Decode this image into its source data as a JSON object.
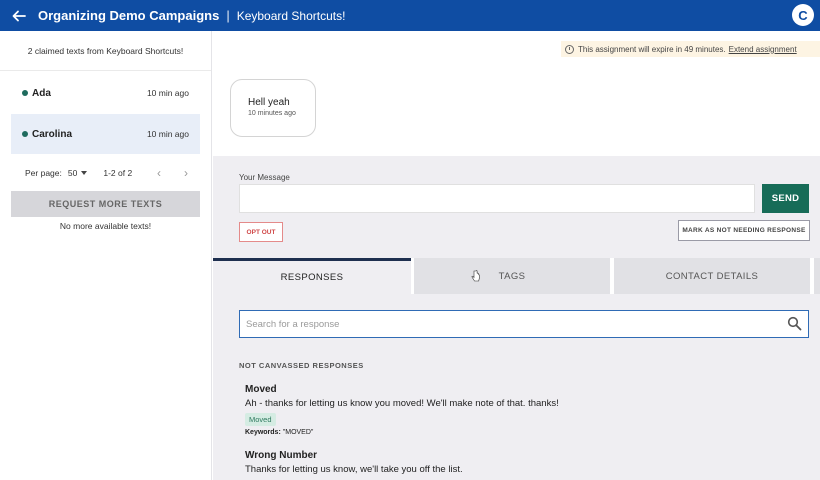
{
  "header": {
    "campaign": "Organizing Demo Campaigns",
    "separator": "|",
    "subtitle": "Keyboard Shortcuts!",
    "avatar_initial": "C",
    "bg_color": "#0f4da3"
  },
  "sidebar": {
    "claimed_text": "2 claimed texts from Keyboard Shortcuts!",
    "contacts": [
      {
        "name": "Ada",
        "time": "10 min ago",
        "active": false
      },
      {
        "name": "Carolina",
        "time": "10 min ago",
        "active": true
      }
    ],
    "pagination": {
      "per_page_label": "Per page:",
      "per_page_value": "50",
      "range": "1-2 of 2",
      "prev_icon": "chevron-left-icon",
      "next_icon": "chevron-right-icon"
    },
    "request_button": "REQUEST MORE TEXTS",
    "no_more": "No more available texts!"
  },
  "main": {
    "expire": {
      "text": "This assignment will expire in 49 minutes.",
      "link": "Extend assignment"
    },
    "message": {
      "text": "Hell yeah",
      "time": "10 minutes ago"
    },
    "compose": {
      "label": "Your Message",
      "input_value": "",
      "send_button": "SEND",
      "opt_out_button": "OPT OUT",
      "mark_button": "MARK AS NOT NEEDING RESPONSE",
      "send_color": "#176c58"
    },
    "tabs": [
      {
        "label": "RESPONSES",
        "active": true
      },
      {
        "label": "TAGS",
        "active": false
      },
      {
        "label": "CONTACT DETAILS",
        "active": false
      }
    ],
    "responses": {
      "search_placeholder": "Search for a response",
      "section_heading": "NOT CANVASSED RESPONSES",
      "items": [
        {
          "title": "Moved",
          "text": "Ah - thanks for letting us know you moved! We'll make note of that. thanks!",
          "tag": "Moved",
          "keywords_label": "Keywords:",
          "keywords": "\"MOVED\""
        },
        {
          "title": "Wrong Number",
          "text": "Thanks for letting us know, we'll take you off the list."
        }
      ]
    }
  }
}
